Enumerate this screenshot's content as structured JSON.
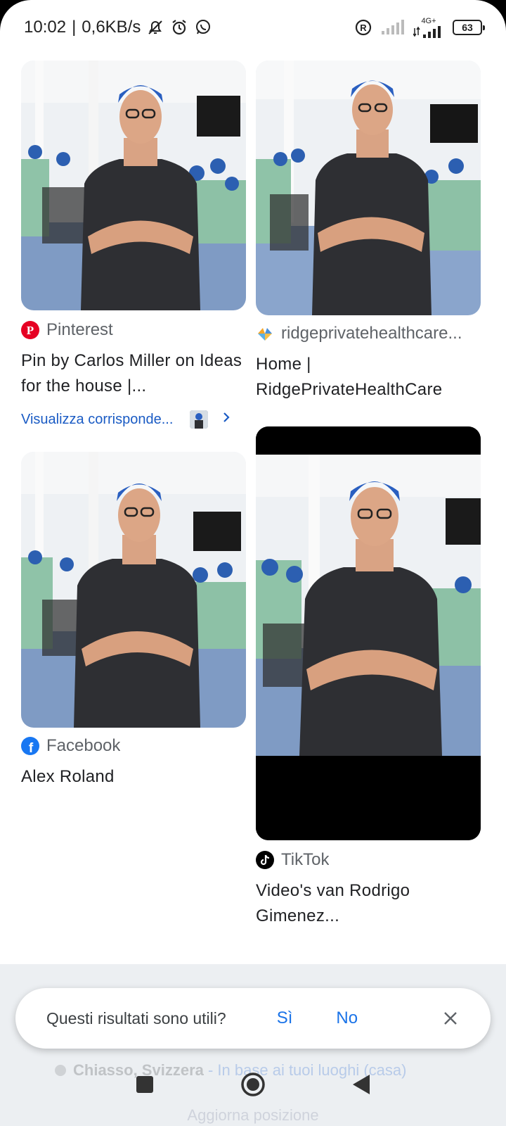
{
  "status_bar": {
    "time": "10:02",
    "speed": "0,6KB/s",
    "separator": "|",
    "network_type": "4G+",
    "battery": "63",
    "icons": [
      "notifications-muted-icon",
      "alarm-icon",
      "whatsapp-icon",
      "registered-icon",
      "signal-icon",
      "signal-4g-icon",
      "battery-icon"
    ]
  },
  "results": [
    {
      "source": "Pinterest",
      "source_icon": "pinterest-icon",
      "title": "Pin by Carlos Miller on Ideas for the house |...",
      "match_link": "Visualizza corrisponde...",
      "accent": "#e60023"
    },
    {
      "source": "ridgeprivatehealthcare...",
      "source_icon": "ridge-icon",
      "title": "Home | RidgePrivateHealthCare"
    },
    {
      "source": "Facebook",
      "source_icon": "facebook-icon",
      "title": "Alex Roland",
      "accent": "#1877f2"
    },
    {
      "source": "TikTok",
      "source_icon": "tiktok-icon",
      "title": "Video's van Rodrigo Gimenez..."
    }
  ],
  "feedback": {
    "question": "Questi risultati sono utili?",
    "yes": "Sì",
    "no": "No"
  },
  "location": {
    "place": "Chiasso, Svizzera",
    "detail": " - In base ai tuoi luoghi (casa)",
    "update": "Aggiorna posizione"
  },
  "colors": {
    "link_blue": "#1a5bc4",
    "text_primary": "#202124",
    "text_secondary": "#5f6368",
    "feedback_bg": "#eceff2"
  }
}
